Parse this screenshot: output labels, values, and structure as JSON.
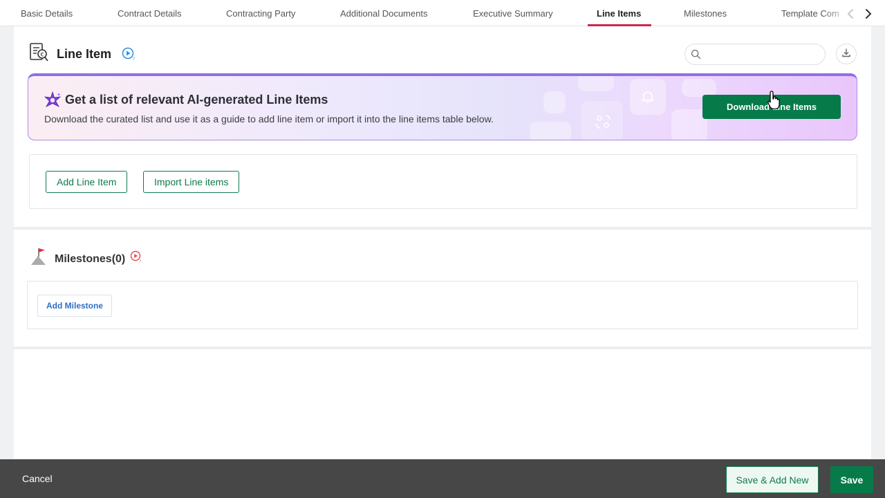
{
  "tabs": {
    "items": [
      {
        "label": "Basic Details"
      },
      {
        "label": "Contract Details"
      },
      {
        "label": "Contracting Party"
      },
      {
        "label": "Additional Documents"
      },
      {
        "label": "Executive Summary"
      },
      {
        "label": "Line Items",
        "active": true
      },
      {
        "label": "Milestones"
      },
      {
        "label": "Template Com"
      }
    ],
    "prev_icon": "chevron-left-icon",
    "next_icon": "chevron-right-icon"
  },
  "line_item": {
    "title": "Line Item",
    "title_icon": "document-currency-icon",
    "video_help_icon": "play-help-icon",
    "search": {
      "value": "",
      "placeholder": ""
    },
    "download_icon": "download-icon",
    "ai_banner": {
      "icon": "sparkle-icon",
      "title": "Get a list of relevant AI-generated Line Items",
      "description": "Download the curated list and use it as a guide to add line item or import it into the line items table below.",
      "button_label": "Download Line Items"
    },
    "add_button": "Add Line Item",
    "import_button": "Import Line items"
  },
  "milestones": {
    "title": "Milestones(0)",
    "icon": "flag-icon",
    "video_help_icon": "play-help-icon",
    "add_button": "Add Milestone"
  },
  "footer": {
    "cancel_label": "Cancel",
    "save_new_label": "Save & Add New",
    "save_label": "Save"
  },
  "colors": {
    "primary_green": "#077a4a",
    "active_tab_underline": "#c8294d",
    "footer_bg": "#474747",
    "banner_border": "#8f6ee8"
  }
}
